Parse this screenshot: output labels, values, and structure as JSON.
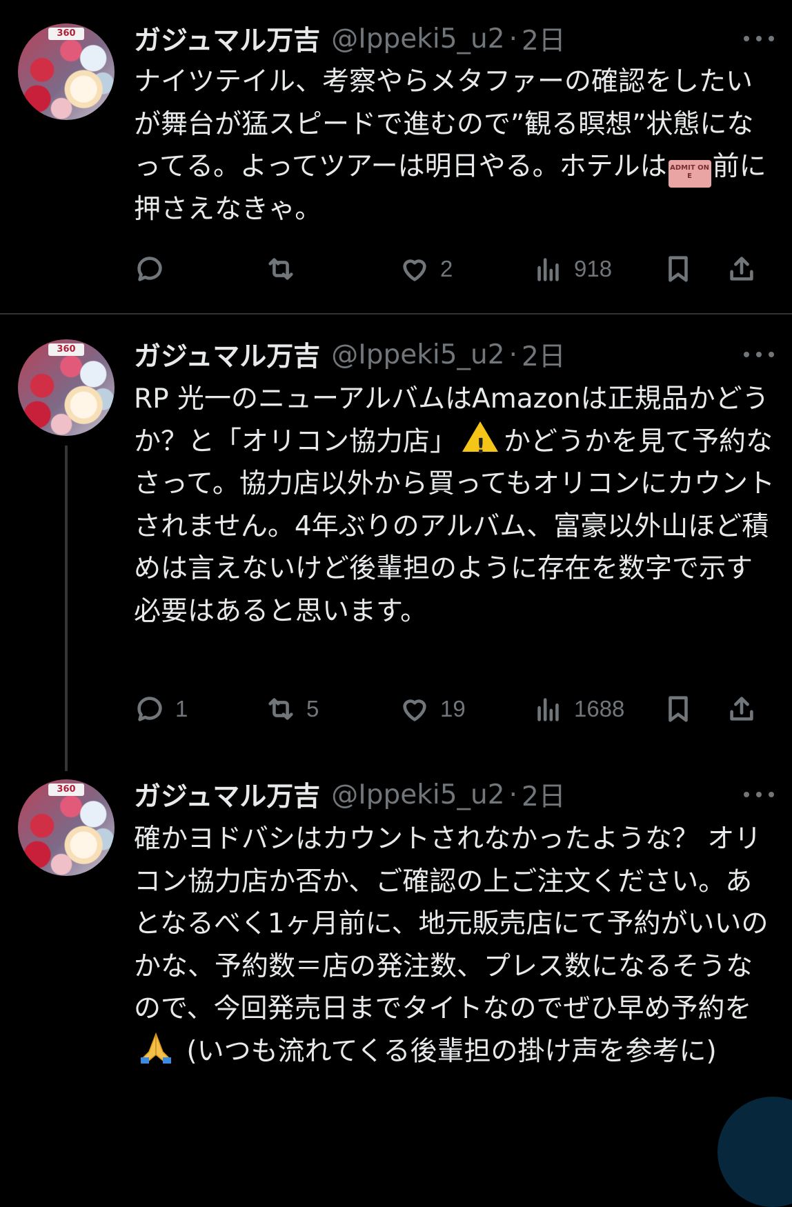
{
  "tweets": [
    {
      "name": "ガジュマル万吉",
      "handle": "@Ippeki5_u2",
      "sep": "·",
      "time": "2日",
      "text_parts": [
        "ナイツテイル、考察やらメタファーの確認をしたいが舞台が猛スピードで進むので”観る瞑想”状態になってる。よってツアーは明日やる。ホテルは",
        "前に押さえなきゃ。"
      ],
      "emoji_ticket": "ADMIT ONE",
      "replies": "",
      "retweets": "",
      "likes": "2",
      "views": "918"
    },
    {
      "name": "ガジュマル万吉",
      "handle": "@Ippeki5_u2",
      "sep": "·",
      "time": "2日",
      "text_parts": [
        "RP 光一のニューアルバムはAmazonは正規品かどうか？と「オリコン協力店」",
        "かどうかを見て予約なさって。協力店以外から買ってもオリコンにカウントされません。4年ぶりのアルバム、富豪以外山ほど積めは言えないけど後輩担のように存在を数字で示す必要はあると思います。"
      ],
      "replies": "1",
      "retweets": "5",
      "likes": "19",
      "views": "1688"
    },
    {
      "name": "ガジュマル万吉",
      "handle": "@Ippeki5_u2",
      "sep": "·",
      "time": "2日",
      "text_parts": [
        "確かヨドバシはカウントされなかったような？ オリコン協力店か否か、ご確認の上ご注文ください。あとなるべく1ヶ月前に、地元販売店にて予約がいいのかな、予約数＝店の発注数、プレス数になるそうなので、今回発売日までタイトなのでぜひ早め予約を",
        " (いつも流れてくる後輩担の掛け声を参考に)"
      ]
    }
  ],
  "avatar_badge": "360",
  "icons": [
    "reply-icon",
    "retweet-icon",
    "like-icon",
    "views-icon",
    "bookmark-icon",
    "share-icon",
    "more-icon"
  ]
}
